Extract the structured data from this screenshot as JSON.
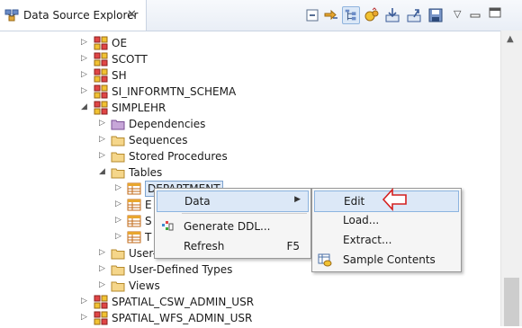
{
  "view": {
    "title": "Data Source Explorer",
    "toolbar": [
      {
        "icon": "collapse-all-icon"
      },
      {
        "icon": "link-with-editor-icon"
      },
      {
        "icon": "filter-icon",
        "active": true
      },
      {
        "icon": "new-connection-profile-icon"
      },
      {
        "icon": "import-icon"
      },
      {
        "icon": "export-icon"
      },
      {
        "icon": "save-icon"
      }
    ]
  },
  "tree": [
    {
      "label": "OE",
      "type": "schema",
      "level": 1,
      "expanded": false
    },
    {
      "label": "SCOTT",
      "type": "schema",
      "level": 1,
      "expanded": false
    },
    {
      "label": "SH",
      "type": "schema",
      "level": 1,
      "expanded": false
    },
    {
      "label": "SI_INFORMTN_SCHEMA",
      "type": "schema",
      "level": 1,
      "expanded": false
    },
    {
      "label": "SIMPLEHR",
      "type": "schema",
      "level": 1,
      "expanded": true
    },
    {
      "label": "Dependencies",
      "type": "folder-purple",
      "level": 2,
      "expanded": false
    },
    {
      "label": "Sequences",
      "type": "folder",
      "level": 2,
      "expanded": false
    },
    {
      "label": "Stored Procedures",
      "type": "folder",
      "level": 2,
      "expanded": false
    },
    {
      "label": "Tables",
      "type": "folder",
      "level": 2,
      "expanded": true
    },
    {
      "label": "DEPARTMENT",
      "type": "table",
      "level": 3,
      "expanded": false,
      "selected": true
    },
    {
      "label": "E",
      "type": "table",
      "level": 3,
      "expanded": false
    },
    {
      "label": "S",
      "type": "table",
      "level": 3,
      "expanded": false
    },
    {
      "label": "T",
      "type": "table",
      "level": 3,
      "expanded": false
    },
    {
      "label": "User-",
      "type": "folder",
      "level": 2,
      "expanded": false
    },
    {
      "label": "User-Defined Types",
      "type": "folder",
      "level": 2,
      "expanded": false
    },
    {
      "label": "Views",
      "type": "folder",
      "level": 2,
      "expanded": false
    },
    {
      "label": "SPATIAL_CSW_ADMIN_USR",
      "type": "schema",
      "level": 1,
      "expanded": false
    },
    {
      "label": "SPATIAL_WFS_ADMIN_USR",
      "type": "schema",
      "level": 1,
      "expanded": false
    }
  ],
  "context_menu": {
    "items": [
      {
        "label": "Data",
        "submenu": true,
        "highlighted": true,
        "icon": ""
      },
      {
        "label": "Generate DDL...",
        "icon": "generate-ddl-icon"
      },
      {
        "label": "Refresh",
        "shortcut": "F5",
        "icon": ""
      }
    ]
  },
  "submenu": {
    "items": [
      {
        "label": "Edit",
        "highlighted": true,
        "icon": ""
      },
      {
        "label": "Load...",
        "icon": ""
      },
      {
        "label": "Extract...",
        "icon": ""
      },
      {
        "label": "Sample Contents",
        "icon": "sample-contents-icon"
      }
    ]
  }
}
